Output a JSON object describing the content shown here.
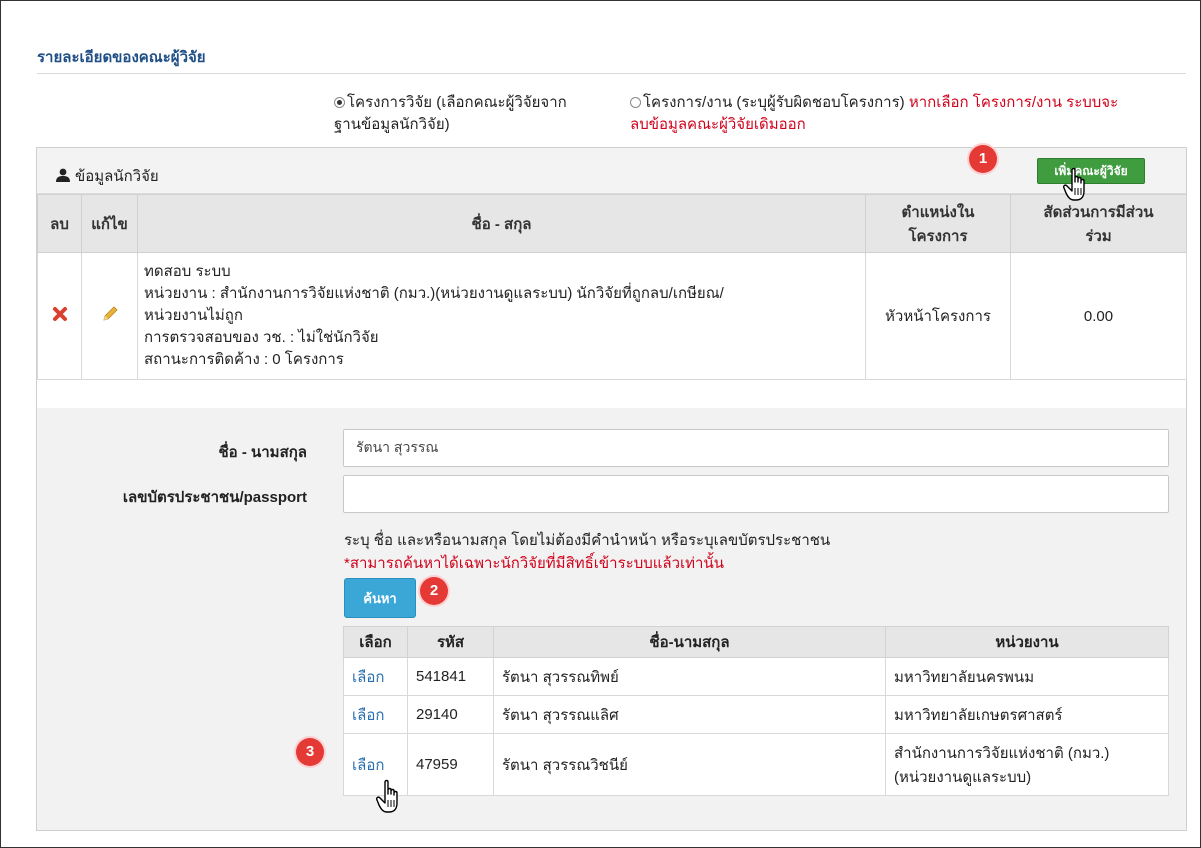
{
  "section_title": "รายละเอียดของคณะผู้วิจัย",
  "project_type": {
    "option_research": {
      "line1": "โครงการวิจัย (เลือกคณะผู้วิจัยจาก",
      "line2": "ฐานข้อมูลนักวิจัย)",
      "selected": true
    },
    "option_work": {
      "line1_normal": "โครงการ/งาน (ระบุผู้รับผิดชอบโครงการ)",
      "line1_warn": "หากเลือก โครงการ/งาน ระบบจะ",
      "line2_warn": "ลบข้อมูลคณะผู้วิจัยเดิมออก",
      "selected": false
    }
  },
  "panel": {
    "title": "ข้อมูลนักวิจัย",
    "add_button": "เพิ่มคณะผู้วิจัย",
    "columns": {
      "delete": "ลบ",
      "edit": "แก้ไข",
      "name": "ชื่อ - สกุล",
      "position_l1": "ตำแหน่งใน",
      "position_l2": "โครงการ",
      "ratio_l1": "สัดส่วนการมีส่วน",
      "ratio_l2": "ร่วม"
    },
    "row": {
      "name": "ทดสอบ ระบบ",
      "agency_l1": "หน่วยงาน : สำนักงานการวิจัยแห่งชาติ (กมว.)(หน่วยงานดูแลระบบ) นักวิจัยที่ถูกลบ/เกษียณ/",
      "agency_l2": "หน่วยงานไม่ถูก",
      "check": "การตรวจสอบของ วช. : ไม่ใช่นักวิจัย",
      "pending": "สถานะการติดค้าง : 0 โครงการ",
      "position": "หัวหน้าโครงการ",
      "ratio": "0.00"
    }
  },
  "search_form": {
    "name_label": "ชื่อ - นามสกุล",
    "name_value": "รัตนา สุวรรณ",
    "id_label": "เลขบัตรประชาชน/passport",
    "id_value": "",
    "hint": "ระบุ ชื่อ และหรือนามสกุล โดยไม่ต้องมีคำนำหน้า หรือระบุเลขบัตรประชาชน",
    "warn": "*สามารถค้นหาได้เฉพาะนักวิจัยที่มีสิทธิ์เข้าระบบแล้วเท่านั้น",
    "search_button": "ค้นหา"
  },
  "results": {
    "headers": [
      "เลือก",
      "รหัส",
      "ชื่อ-นามสกุล",
      "หน่วยงาน"
    ],
    "rows": [
      {
        "pick": "เลือก",
        "code": "541841",
        "name": "รัตนา สุวรรณทิพย์",
        "agency_l1": "มหาวิทยาลัยนครพนม",
        "agency_l2": ""
      },
      {
        "pick": "เลือก",
        "code": "29140",
        "name": "รัตนา สุวรรณแลิศ",
        "agency_l1": "มหาวิทยาลัยเกษตรศาสตร์",
        "agency_l2": ""
      },
      {
        "pick": "เลือก",
        "code": "47959",
        "name": "รัตนา สุวรรณวิชนีย์",
        "agency_l1": "สำนักงานการวิจัยแห่งชาติ (กมว.)",
        "agency_l2": "(หน่วยงานดูแลระบบ)"
      }
    ]
  },
  "step_badges": [
    "1",
    "2",
    "3"
  ],
  "colors": {
    "title": "#1f4f86",
    "warn": "#d0021b",
    "add_button": "#3f9c3f",
    "search_button": "#3ba7d6",
    "badge": "#e53935",
    "link": "#2a6fb0"
  },
  "icons": {
    "delete": "x-icon",
    "edit": "pencil-icon",
    "panel": "user-icon",
    "cursor": "hand-pointer-icon"
  }
}
